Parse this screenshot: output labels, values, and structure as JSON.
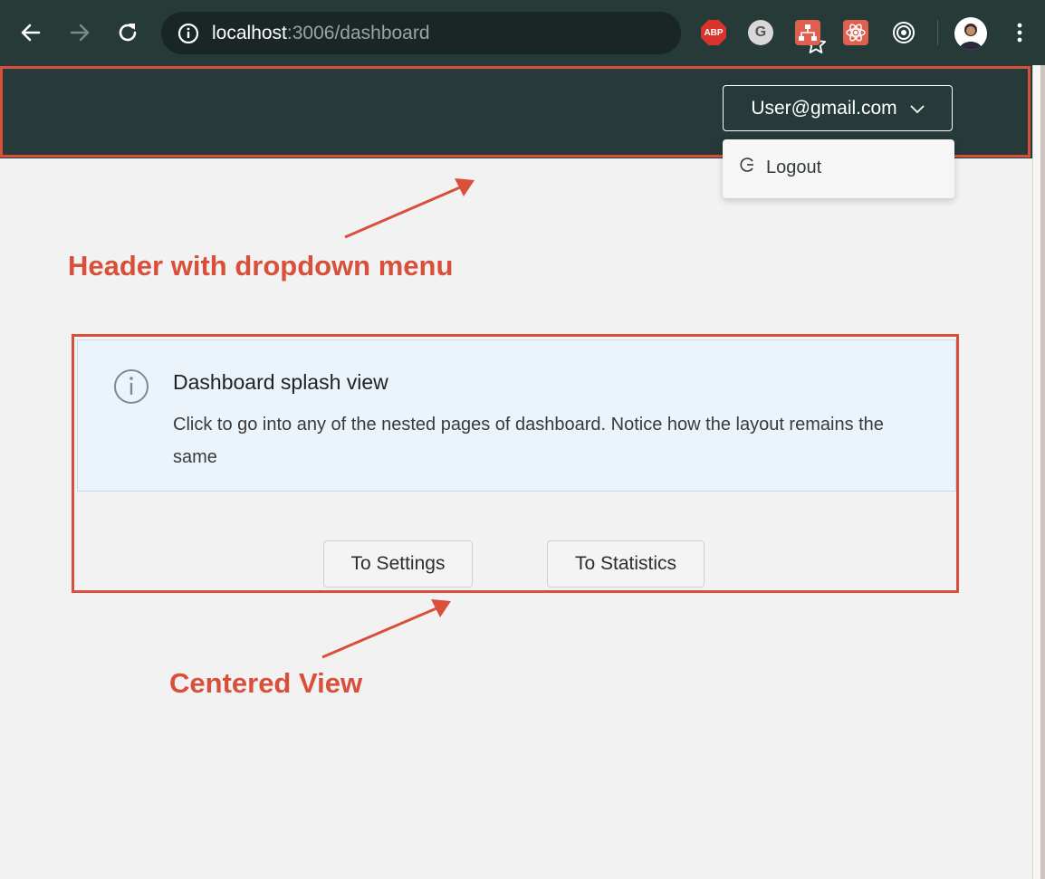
{
  "browser": {
    "url_host": "localhost",
    "url_rest": ":3006/dashboard",
    "extensions": {
      "abp_label": "ABP",
      "grammarly_label": "G"
    }
  },
  "header": {
    "user_email": "User@gmail.com",
    "dropdown": {
      "logout_label": "Logout"
    }
  },
  "splash": {
    "title": "Dashboard splash view",
    "body": "Click to go into any of the nested pages of dashboard. Notice how the layout remains the same"
  },
  "actions": {
    "settings_label": "To Settings",
    "statistics_label": "To Statistics"
  },
  "annotations": {
    "header_note": "Header with dropdown menu",
    "center_note": "Centered View"
  },
  "colors": {
    "header_bg": "#273a3a",
    "annotation": "#d9503a",
    "alert_bg": "#ecf4fb"
  },
  "icons": {
    "back": "arrow-left-icon",
    "forward": "arrow-right-icon",
    "reload": "reload-icon",
    "site_info": "info-circle-icon",
    "bookmark": "star-icon",
    "menu": "kebab-icon",
    "dropdown_caret": "chevron-down-icon",
    "logout": "logout-icon",
    "alert": "info-circle-icon"
  }
}
